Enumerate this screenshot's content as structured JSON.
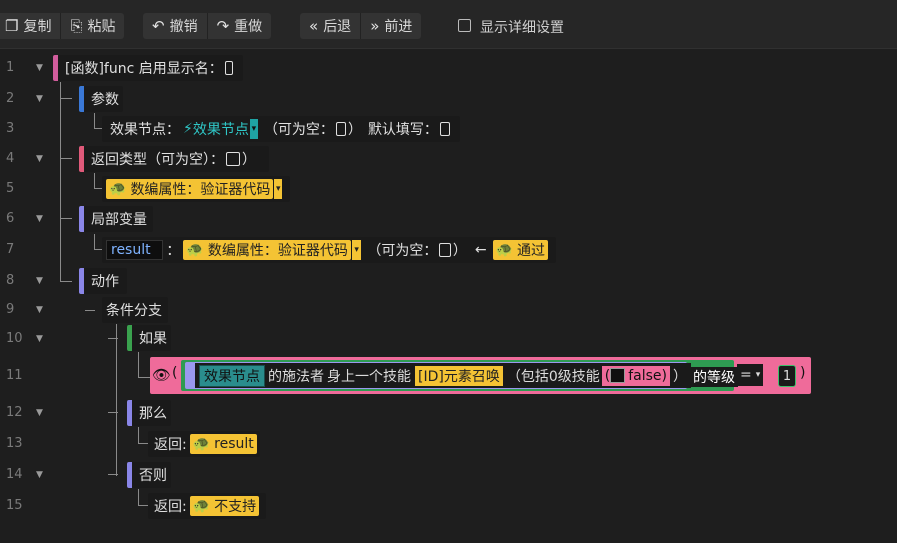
{
  "toolbar": {
    "copy": "复制",
    "paste": "粘贴",
    "undo": "撤销",
    "redo": "重做",
    "back": "后退",
    "forward": "前进",
    "show_details": "显示详细设置"
  },
  "lines": [
    "1",
    "2",
    "3",
    "4",
    "5",
    "6",
    "7",
    "8",
    "9",
    "10",
    "11",
    "12",
    "13",
    "14",
    "15"
  ],
  "func": {
    "label": "[函数]func 启用显示名："
  },
  "params": {
    "title": "参数",
    "node_label": "效果节点：",
    "node_type": "效果节点",
    "nullable": "（可为空：",
    "nullable_close": "）",
    "default": "默认填写："
  },
  "ret": {
    "title": "返回类型（可为空）：",
    "close": "）",
    "type": "数编属性：验证器代码"
  },
  "locals": {
    "title": "局部变量",
    "var_name": "result",
    "colon": "：",
    "type": "数编属性：验证器代码",
    "nullable": "（可为空：",
    "nullable_close": "）",
    "arrow": "←",
    "value": "通过"
  },
  "actions": {
    "title": "动作",
    "branch": "条件分支",
    "if": "如果",
    "then": "那么",
    "else": "否则",
    "return_label": "返回:",
    "return_then": "result",
    "return_else": "不支持"
  },
  "condition": {
    "open": "(",
    "node": "效果节点",
    "caster": "的施法者",
    "prev_skill": "身上一个技能",
    "skill_id": "[ID]元素召唤",
    "incl": "（包括0级技能",
    "flag_open": "(",
    "flag": "false",
    "flag_close": ")",
    "close_paren": "）",
    "level": "的等级",
    "op": "=",
    "value": "1",
    "end": ")"
  }
}
